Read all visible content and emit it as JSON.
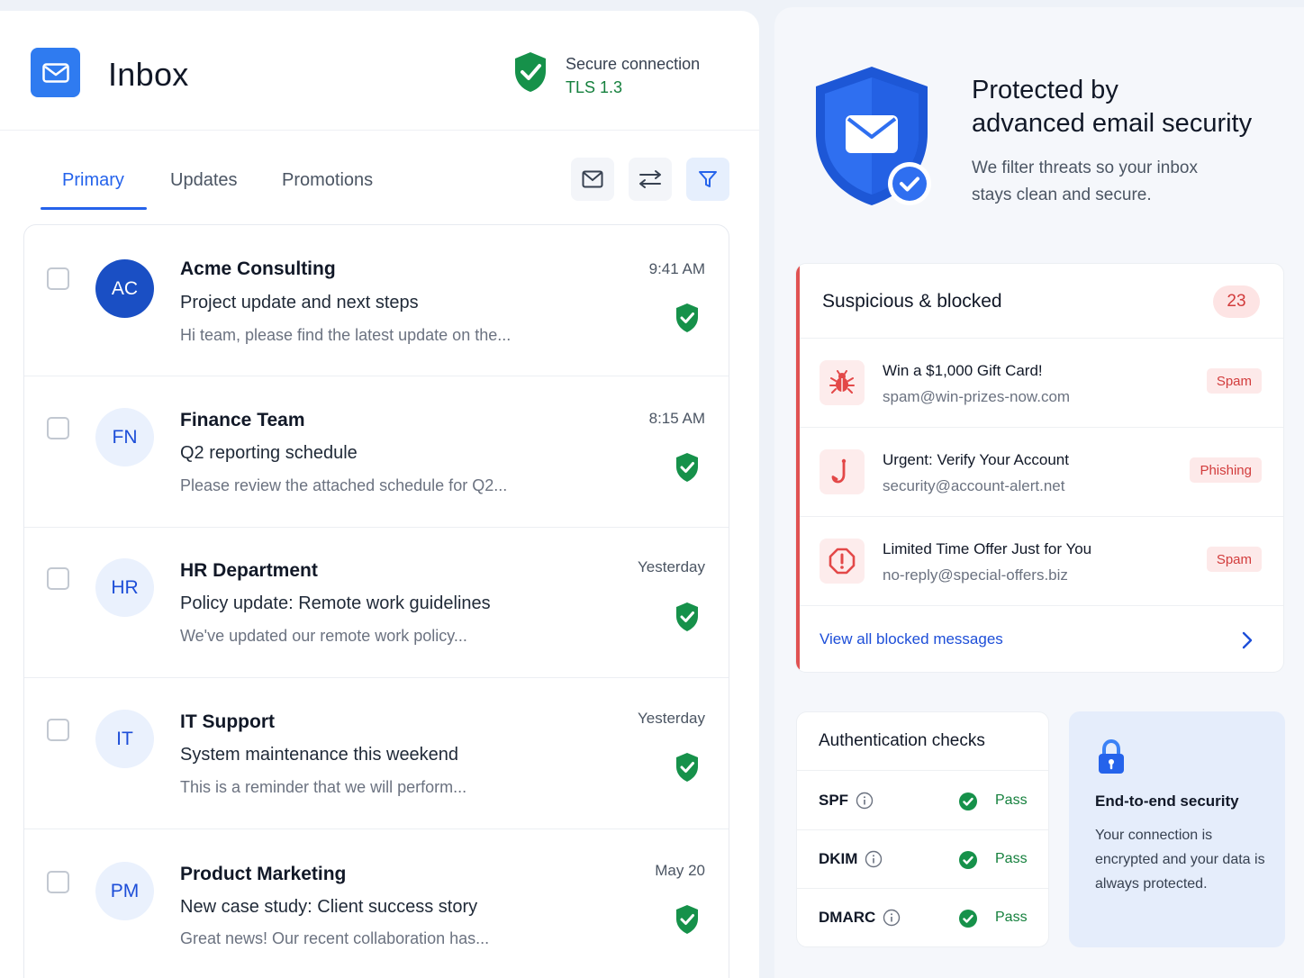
{
  "colors": {
    "accent": "#2563eb",
    "secure_green": "#15803d",
    "danger": "#d23c3c",
    "avatar_primary": "#1a4fc4"
  },
  "header": {
    "title": "Inbox",
    "secure_label": "Secure connection",
    "secure_protocol": "TLS 1.3"
  },
  "tabs": [
    {
      "label": "Primary",
      "active": true
    },
    {
      "label": "Updates",
      "active": false
    },
    {
      "label": "Promotions",
      "active": false
    }
  ],
  "toolbar": {
    "icons": [
      "mail-icon",
      "sliders-icon",
      "filter-icon"
    ]
  },
  "emails": [
    {
      "initials": "AC",
      "sender": "Acme Consulting",
      "subject": "Project update and next steps",
      "preview": "Hi team, please find the latest update on the...",
      "time": "9:41 AM",
      "verified": true
    },
    {
      "initials": "FN",
      "sender": "Finance Team",
      "subject": "Q2 reporting schedule",
      "preview": "Please review the attached schedule for Q2...",
      "time": "8:15 AM",
      "verified": true
    },
    {
      "initials": "HR",
      "sender": "HR Department",
      "subject": "Policy update: Remote work guidelines",
      "preview": "We've updated our remote work policy...",
      "time": "Yesterday",
      "verified": true
    },
    {
      "initials": "IT",
      "sender": "IT Support",
      "subject": "System maintenance this weekend",
      "preview": "This is a reminder that we will perform...",
      "time": "Yesterday",
      "verified": true
    },
    {
      "initials": "PM",
      "sender": "Product Marketing",
      "subject": "New case study: Client success story",
      "preview": "Great news! Our recent collaboration has...",
      "time": "May 20",
      "verified": true
    }
  ],
  "hero": {
    "title_line1": "Protected by",
    "title_line2": "advanced email security",
    "subtitle_line1": "We filter threats so your inbox",
    "subtitle_line2": "stays clean and secure."
  },
  "blocked": {
    "title": "Suspicious & blocked",
    "count": "23",
    "items": [
      {
        "icon": "bug-icon",
        "subject": "Win a $1,000 Gift Card!",
        "from": "spam@win-prizes-now.com",
        "tag": "Spam"
      },
      {
        "icon": "hook-icon",
        "subject": "Urgent: Verify Your Account",
        "from": "security@account-alert.net",
        "tag": "Phishing"
      },
      {
        "icon": "alert-icon",
        "subject": "Limited Time Offer Just for You",
        "from": "no-reply@special-offers.biz",
        "tag": "Spam"
      }
    ],
    "view_all": "View all blocked messages"
  },
  "auth": {
    "title": "Authentication checks",
    "checks": [
      {
        "name": "SPF",
        "status": "Pass"
      },
      {
        "name": "DKIM",
        "status": "Pass"
      },
      {
        "name": "DMARC",
        "status": "Pass"
      }
    ]
  },
  "e2e": {
    "title": "End-to-end security",
    "text": "Your connection is encrypted and your data is always protected."
  }
}
